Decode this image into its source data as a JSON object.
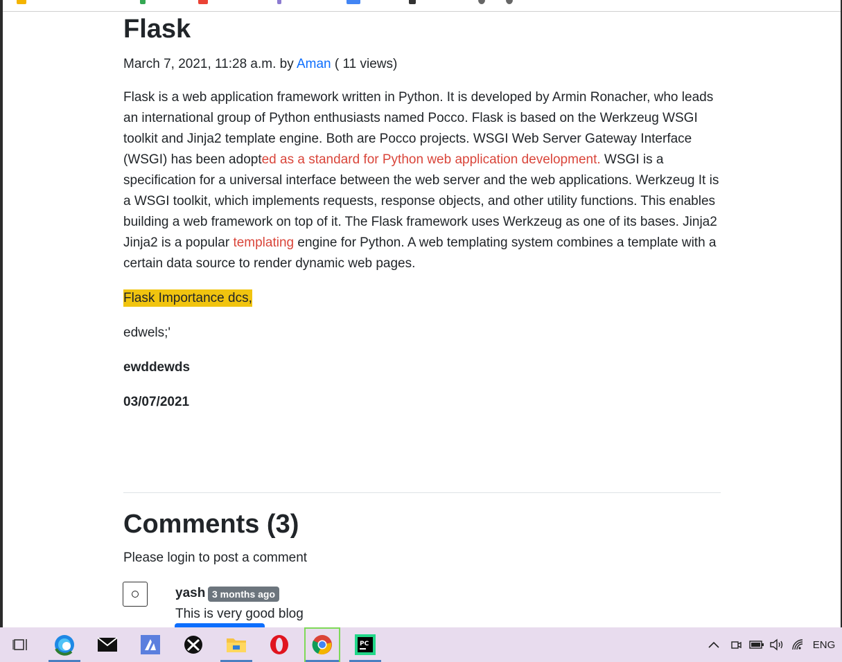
{
  "post": {
    "title": "Flask",
    "date": "March 7, 2021, 11:28 a.m. by ",
    "author": "Aman",
    "views": " ( 11 views)",
    "body_p1_a": "Flask is a web application framework written in Python. It is developed by Armin Ronacher, who leads an international group of Python enthusiasts named Pocco. Flask is based on the Werkzeug WSGI toolkit and Jinja2 template engine. Both are Pocco projects. WSGI Web Server Gateway Interface (WSGI) has been adopt",
    "body_p1_red": "ed as a standard for Python web application development.",
    "body_p1_b": " WSGI is a specification for a universal interface between the web server and the web applications. Werkzeug It is a WSGI toolkit, which implements requests, response objects, and other utility functions. This enables building a web framework on top of it. The Flask framework uses Werkzeug as one of its bases. Jinja2 Jinja2 is a popular ",
    "body_p1_link": "templating",
    "body_p1_c": " engine for Python. A web templating system combines a template with a certain data source to render dynamic web pages.",
    "highlight": "Flask Importance dcs,",
    "line2": "edwels;'",
    "line3": "ewddewds",
    "line4": "03/07/2021"
  },
  "comments": {
    "heading": "Comments (3)",
    "login_note": "Please login to post a comment",
    "items": [
      {
        "user": "yash",
        "time": "3 months ago",
        "text": "This is very good blog"
      }
    ]
  },
  "taskbar": {
    "language": "ENG",
    "apps": [
      "task-view",
      "edge",
      "mail",
      "app-a",
      "xbox",
      "file-explorer",
      "opera",
      "chrome",
      "pycharm"
    ]
  },
  "colors": {
    "link": "#0d6efd",
    "red_text": "#d9453a",
    "highlight": "#f1c40f",
    "badge": "#6c757d",
    "taskbar": "#e8dcee"
  }
}
